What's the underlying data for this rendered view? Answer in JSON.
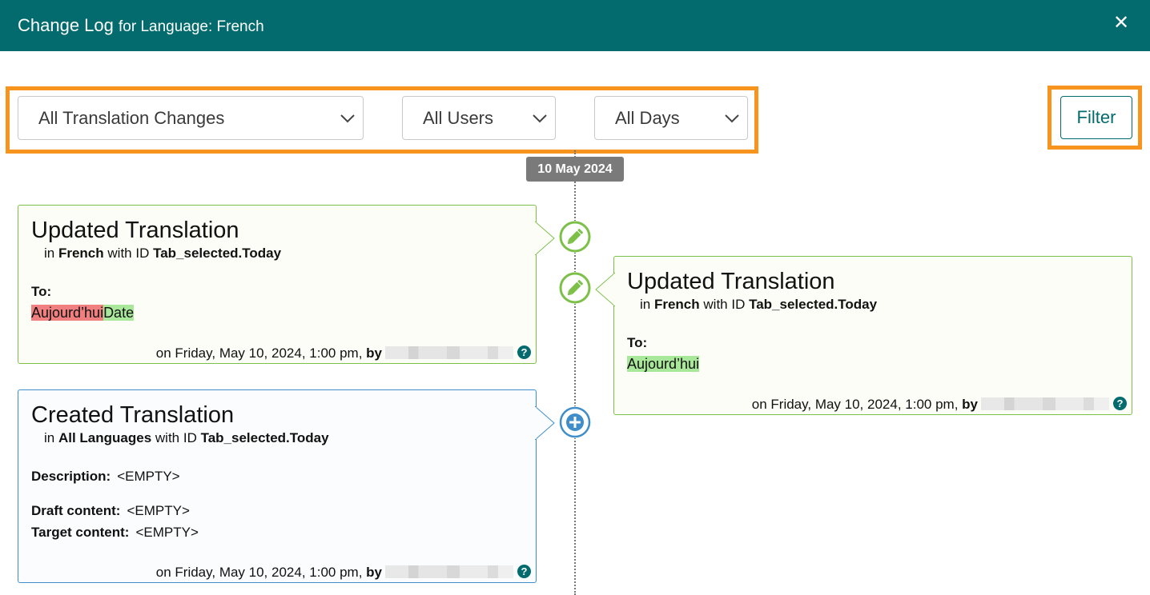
{
  "header": {
    "title_main": "Change Log",
    "title_sub": "for Language: French",
    "close_glyph": "✕"
  },
  "filters": {
    "change_type": "All Translation Changes",
    "users": "All Users",
    "days": "All Days",
    "filter_button": "Filter"
  },
  "timeline": {
    "date_label": "10 May 2024"
  },
  "entries": [
    {
      "title": "Updated Translation",
      "in_text": "in",
      "language": "French",
      "with_text": "with ID",
      "id": "Tab_selected.Today",
      "to_label": "To:",
      "removed_text": "Aujourd’hui",
      "added_text": "Date",
      "meta_text": "on Friday, May 10, 2024, 1:00 pm,",
      "by_label": "by",
      "icon": "pencil-icon"
    },
    {
      "title": "Updated Translation",
      "in_text": "in",
      "language": "French",
      "with_text": "with ID",
      "id": "Tab_selected.Today",
      "to_label": "To:",
      "added_text": "Aujourd’hui",
      "meta_text": "on Friday, May 10, 2024, 1:00 pm,",
      "by_label": "by",
      "icon": "pencil-icon"
    },
    {
      "title": "Created Translation",
      "in_text": "in",
      "language": "All Languages",
      "with_text": "with ID",
      "id": "Tab_selected.Today",
      "description_label": "Description:",
      "description_value": "<EMPTY>",
      "draft_label": "Draft content:",
      "draft_value": "<EMPTY>",
      "target_label": "Target content:",
      "target_value": "<EMPTY>",
      "meta_text": "on Friday, May 10, 2024, 1:00 pm,",
      "by_label": "by",
      "icon": "plus-circle-icon"
    }
  ],
  "help_glyph": "?",
  "colors": {
    "header_bg": "#036b6d",
    "highlight": "#f7941d",
    "update_accent": "#7cc04a",
    "create_accent": "#3f8ec9",
    "removed_bg": "#f08080",
    "added_bg": "#a9e89a"
  }
}
